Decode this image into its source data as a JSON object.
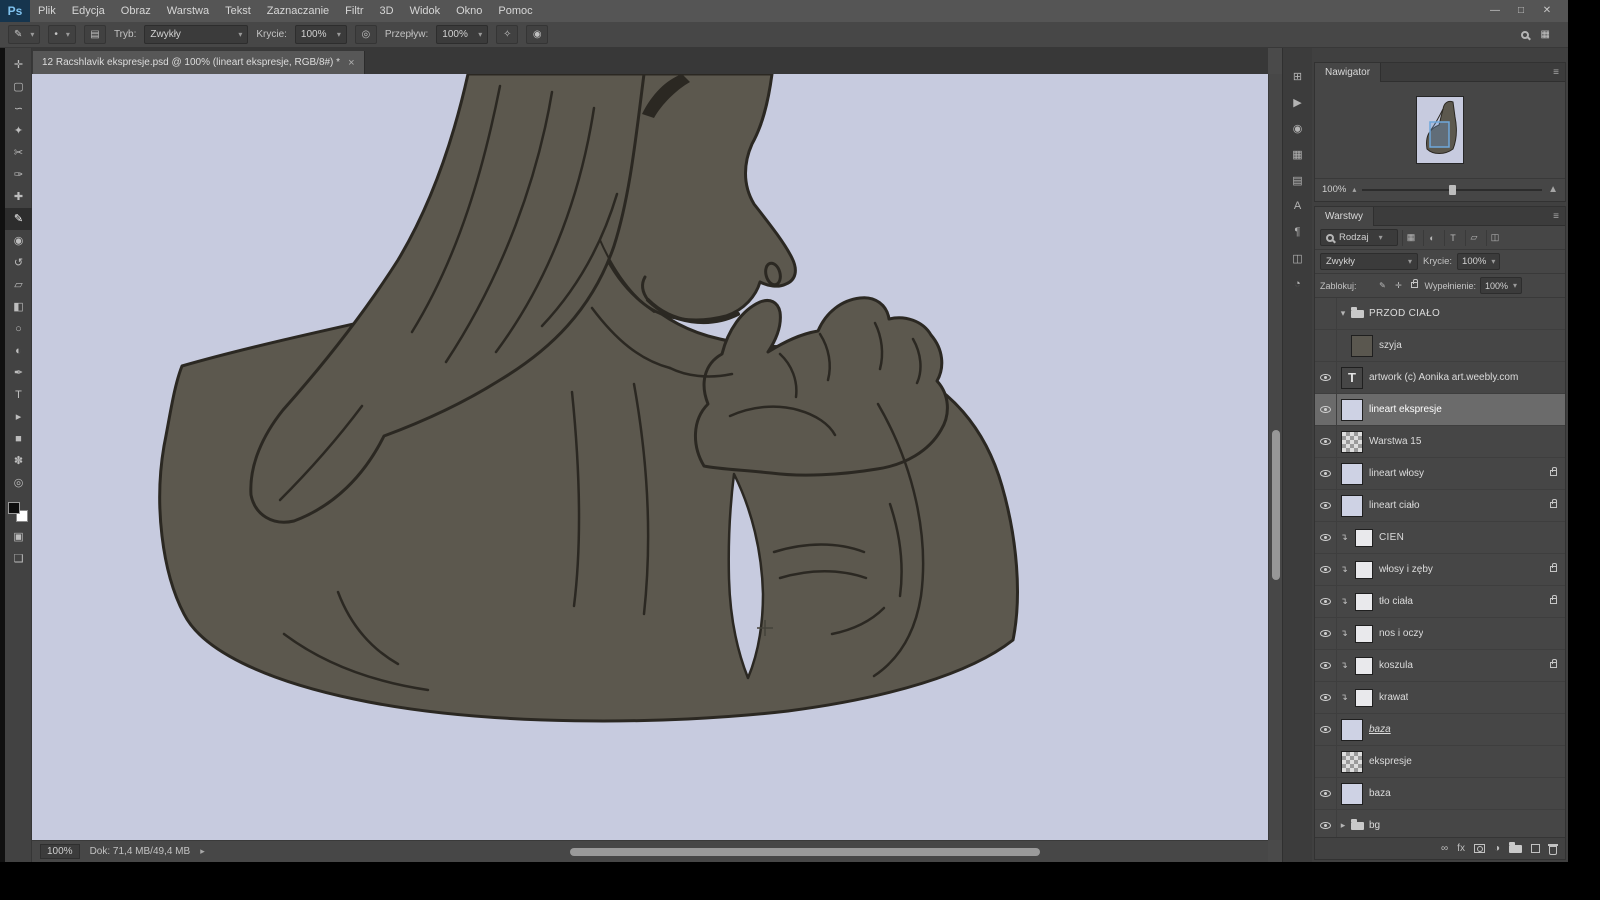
{
  "titlebar": {
    "app_badge": "Ps",
    "menus": [
      "Plik",
      "Edycja",
      "Obraz",
      "Warstwa",
      "Tekst",
      "Zaznaczanie",
      "Filtr",
      "3D",
      "Widok",
      "Okno",
      "Pomoc"
    ],
    "window_controls": [
      "—",
      "□",
      "✕"
    ]
  },
  "options_bar": {
    "tool_icon_glyph": "✎",
    "brush_preset_glyph": "•",
    "toggle_panel_glyph": "▤",
    "mode_label": "Tryb:",
    "mode_value": "Zwykły",
    "opacity_label": "Krycie:",
    "opacity_value": "100%",
    "pressure_opacity_glyph": "◎",
    "flow_label": "Przepływ:",
    "flow_value": "100%",
    "airbrush_glyph": "✧",
    "pressure_size_glyph": "◉",
    "dropdown_arrow": "▾",
    "workspace_glyph": "▦"
  },
  "tab": {
    "title": "12 Racshlavik ekspresje.psd @ 100% (lineart ekspresje, RGB/8#) *",
    "close_glyph": "×"
  },
  "toolbar": {
    "tools": [
      {
        "name": "move",
        "glyph": "✛"
      },
      {
        "name": "marquee",
        "glyph": "▢"
      },
      {
        "name": "lasso",
        "glyph": "∽"
      },
      {
        "name": "quick-selection",
        "glyph": "✦"
      },
      {
        "name": "crop",
        "glyph": "✂"
      },
      {
        "name": "eyedropper",
        "glyph": "✑"
      },
      {
        "name": "healing-brush",
        "glyph": "✚"
      },
      {
        "name": "brush",
        "glyph": "✎",
        "active": true
      },
      {
        "name": "clone-stamp",
        "glyph": "◉"
      },
      {
        "name": "history-brush",
        "glyph": "↺"
      },
      {
        "name": "eraser",
        "glyph": "▱"
      },
      {
        "name": "gradient",
        "glyph": "◧"
      },
      {
        "name": "blur",
        "glyph": "○"
      },
      {
        "name": "dodge",
        "glyph": "◐"
      },
      {
        "name": "pen",
        "glyph": "✒"
      },
      {
        "name": "type",
        "glyph": "T"
      },
      {
        "name": "path-selection",
        "glyph": "▸"
      },
      {
        "name": "rectangle",
        "glyph": "■"
      },
      {
        "name": "hand",
        "glyph": "✽"
      },
      {
        "name": "zoom",
        "glyph": "◎"
      }
    ],
    "quick_mask_glyph": "▣",
    "screen_mode_glyph": "❑"
  },
  "dock_strip": {
    "icons": [
      {
        "name": "mini-bridge-panel",
        "glyph": "⊞"
      },
      {
        "name": "actions-panel",
        "glyph": "▶"
      },
      {
        "name": "clone-source-panel",
        "glyph": "◉"
      },
      {
        "name": "brush-panel",
        "glyph": "▦"
      },
      {
        "name": "brush-presets-panel",
        "glyph": "▤"
      },
      {
        "name": "character-panel",
        "glyph": "A"
      },
      {
        "name": "paragraph-panel",
        "glyph": "¶"
      },
      {
        "name": "layer-comps-panel",
        "glyph": "◫"
      },
      {
        "name": "histogram-panel",
        "glyph": "◔"
      }
    ]
  },
  "navigator": {
    "title": "Nawigator",
    "zoom": "100%",
    "menu_glyph": "≡",
    "zoom_out_glyph": "▴",
    "zoom_in_glyph": "▲"
  },
  "statusbar": {
    "zoom": "100%",
    "doc_info": "Dok: 71,4 MB/49,4 MB",
    "arrow": "▸"
  },
  "layers": {
    "title": "Warstwy",
    "menu_glyph": "≡",
    "filter_label": "Rodzaj",
    "filter_icons": [
      "▦",
      "◐",
      "T",
      "▱",
      "◫"
    ],
    "blend_mode": "Zwykły",
    "opacity_label": "Krycie:",
    "opacity_value": "100%",
    "lock_label": "Zablokuj:",
    "lock_brush_glyph": "✎",
    "lock_move_glyph": "✛",
    "fill_label": "Wypełnienie:",
    "fill_value": "100%",
    "dropdown_arrow": "▾",
    "clip_glyph": "↴",
    "text_thumb_glyph": "T",
    "expanded_glyph": "▾",
    "collapsed_glyph": "▸",
    "link_glyph": "∞",
    "fx_label": "fx",
    "adjustment_glyph": "◑",
    "rows": [
      {
        "name": "PRZÓD CIAŁO",
        "type": "group",
        "visible": false,
        "expanded": true
      },
      {
        "name": "szyja",
        "type": "layer",
        "visible": false,
        "child": true
      },
      {
        "name": "artwork (c) Aonika art.weebly.com",
        "type": "text",
        "visible": true
      },
      {
        "name": "lineart ekspresje",
        "type": "layer",
        "visible": true,
        "selected": true
      },
      {
        "name": "Warstwa 15",
        "type": "layer",
        "visible": true
      },
      {
        "name": "lineart włosy",
        "type": "layer",
        "visible": true,
        "locked": true
      },
      {
        "name": "lineart ciało",
        "type": "layer",
        "visible": true,
        "locked": true
      },
      {
        "name": "CIEŃ",
        "type": "layer",
        "visible": true,
        "clipped": true
      },
      {
        "name": "włosy i zęby",
        "type": "layer",
        "visible": true,
        "clipped": true,
        "locked": true
      },
      {
        "name": "tło ciała",
        "type": "layer",
        "visible": true,
        "clipped": true,
        "locked": true
      },
      {
        "name": "nos i oczy",
        "type": "layer",
        "visible": true,
        "clipped": true
      },
      {
        "name": "koszula",
        "type": "layer",
        "visible": true,
        "clipped": true,
        "locked": true
      },
      {
        "name": "krawat",
        "type": "layer",
        "visible": true,
        "clipped": true
      },
      {
        "name": "baza",
        "type": "layer",
        "visible": true,
        "underlined": true
      },
      {
        "name": "ekspresje",
        "type": "layer",
        "visible": false
      },
      {
        "name": "baza",
        "type": "layer",
        "visible": true
      },
      {
        "name": "bg",
        "type": "group",
        "visible": true,
        "expanded": false
      }
    ]
  }
}
